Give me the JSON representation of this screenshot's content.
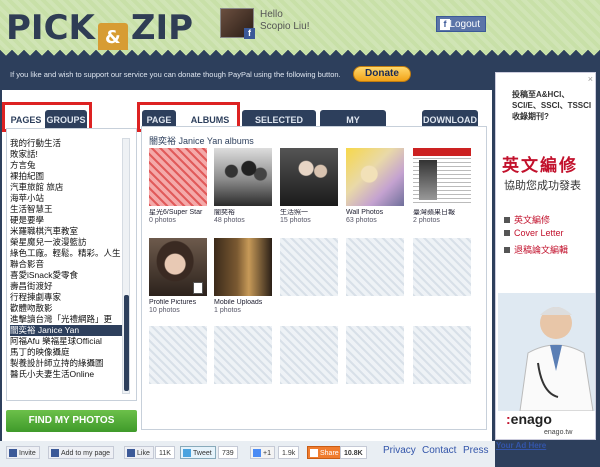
{
  "header": {
    "logo_left": "PICK",
    "logo_amp": "&",
    "logo_right": "ZIP",
    "hello": "Hello",
    "user_name": "Scopio Liu!",
    "logout_label": "Logout"
  },
  "donate": {
    "text": "If you like and wish to support our service you can donate though PayPal using the following button.",
    "button_label": "Donate"
  },
  "left_tabs": [
    {
      "label": "PAGES",
      "active": true
    },
    {
      "label": "GROUPS",
      "active": false
    }
  ],
  "page_list": [
    "我的行動生活",
    "敗家話!",
    "方言兔",
    "裸拍紀圖",
    "汽車旅館 旅店",
    "海苹小站",
    "生活智慧王",
    "硬是要學",
    "米羅職棋汽車教室",
    "榮星魔兒一波漫籃訪",
    "綠色工廠。輕鬆。精彩。人生",
    "聯合影音",
    "喜愛iSnack愛零食",
    "壽昌街渡好",
    "行程揀劇專家",
    "歡體吻散影",
    "進擊讀台灣「光禮網路」更",
    "闇奕裕 Janice Yan",
    "阿福Afu 樂福星球Official",
    "馬丁的映像攝庭",
    "製養設計師立持的綠攝圖",
    "醫氏小夫妻生活Online"
  ],
  "selected_page_index": 17,
  "find_button": "FIND MY PHOTOS",
  "album_tabs": [
    {
      "label": "PAGE",
      "active": false
    },
    {
      "label": "ALBUMS",
      "active": true
    },
    {
      "label": "SELECTED ALBUM",
      "active": false
    },
    {
      "label": "MY SELECTION",
      "active": false
    },
    {
      "label": "DOWNLOAD",
      "active": false
    }
  ],
  "albums_title": "闇奕裕 Janice Yan albums",
  "albums": [
    {
      "name": "星光6/Super Star",
      "count": "0 photos",
      "style": "pink"
    },
    {
      "name": "闇奕裕",
      "count": "48 photos",
      "style": "photo-group"
    },
    {
      "name": "生活照一",
      "count": "15 photos",
      "style": "photo-dark"
    },
    {
      "name": "Wall Photos",
      "count": "63 photos",
      "style": "photo-color"
    },
    {
      "name": "臺灣蘋果日報",
      "count": "2 photos",
      "style": "photo-news"
    },
    {
      "name": "Profile Pictures",
      "count": "10 photos",
      "style": "photo-portrait"
    },
    {
      "name": "Mobile Uploads",
      "count": "1 photos",
      "style": "photo-room"
    }
  ],
  "ad": {
    "top_text": "投稿至A&HCI、SCI/E、SSCI、TSSCI收錄期刊?",
    "big_text": "英文編修",
    "sub_text": "協助您成功發表",
    "items": [
      "英文編修",
      "Cover Letter",
      "退稿論文編輯"
    ],
    "brand": "enago",
    "url": "enago.tw",
    "close": "×",
    "your_ad": "Your Ad Here"
  },
  "footer": {
    "invite": "Invite",
    "add_to_page": "Add to my page",
    "like": "Like",
    "like_count": "11K",
    "tweet": "Tweet",
    "tweet_count": "739",
    "plus_one": "+1",
    "plus_count": "1.9k",
    "share": "Share",
    "share_count": "10.8K",
    "links": [
      "Privacy",
      "Contact",
      "Press"
    ]
  }
}
